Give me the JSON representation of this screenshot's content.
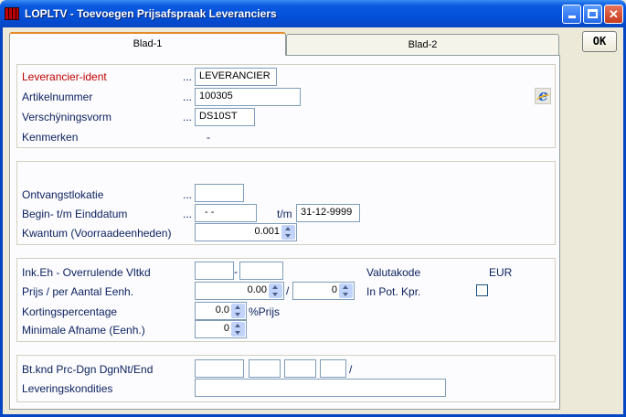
{
  "window": {
    "title": "LOPLTV - Toevoegen Prijsafspraak Leveranciers"
  },
  "tabs": [
    {
      "label": "Blad-1"
    },
    {
      "label": "Blad-2"
    }
  ],
  "ok_label": "OK",
  "dots": "...",
  "group1": {
    "leverancier_label": "Leverancier-ident",
    "leverancier_value": "LEVERANCIER",
    "artikel_label": "Artikelnummer",
    "artikel_value": "100305",
    "verschijning_label": "Verschÿningsvorm",
    "verschijning_value": "DS10ST",
    "kenmerken_label": "Kenmerken",
    "kenmerken_value": "-"
  },
  "group2": {
    "ontvangst_label": "Ontvangstlokatie",
    "ontvangst_value": "",
    "begin_label": "Begin- t/m Einddatum",
    "begin_value": "- -",
    "tm_label": "t/m",
    "eind_value": "31-12-9999",
    "kwantum_label": "Kwantum (Voorraadeenheden)",
    "kwantum_value": "0.001"
  },
  "group3": {
    "inkeh_label": "Ink.Eh - Overrulende Vltkd",
    "inkeh_dash": "-",
    "valutakode_label": "Valutakode",
    "valutakode_value": "EUR",
    "prijs_label": "Prijs / per Aantal Eenh.",
    "prijs_value": "0.00",
    "slash": "/",
    "aantal_value": "0",
    "inpot_label": "In Pot. Kpr.",
    "korting_label": "Kortingspercentage",
    "korting_value": "0.0",
    "korting_unit": "%Prijs",
    "minimale_label": "Minimale Afname (Eenh.)",
    "minimale_value": "0"
  },
  "group4": {
    "btknd_label": "Bt.knd Prc-Dgn DgnNt/End",
    "slash": "/",
    "levering_label": "Leveringskondities"
  }
}
